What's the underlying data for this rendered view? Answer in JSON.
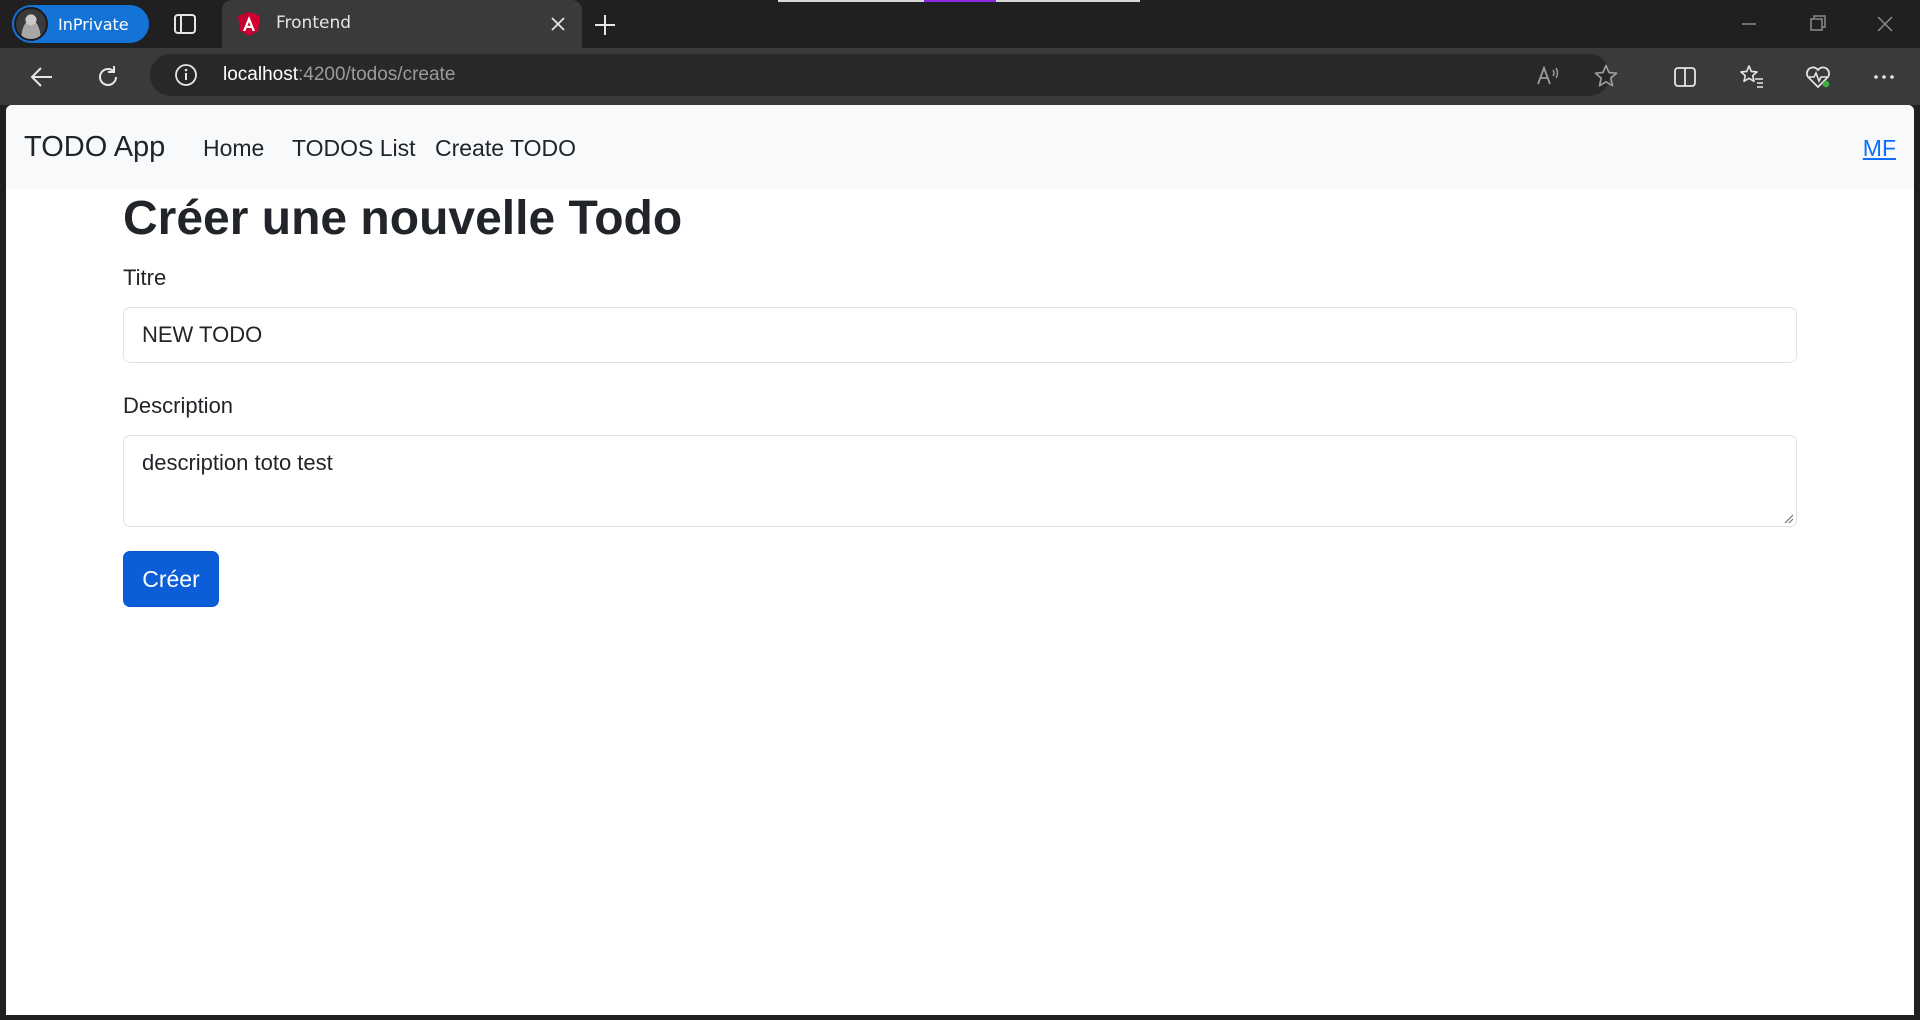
{
  "browser": {
    "profile_label": "InPrivate",
    "tab_title": "Frontend",
    "url_host": "localhost",
    "url_path": ":4200/todos/create"
  },
  "app": {
    "brand": "TODO App",
    "nav": [
      {
        "label": "Home"
      },
      {
        "label": "TODOS List"
      },
      {
        "label": "Create TODO"
      }
    ],
    "user_initials": "MF"
  },
  "form": {
    "heading": "Créer une nouvelle Todo",
    "title_label": "Titre",
    "title_value": "NEW TODO",
    "description_label": "Description",
    "description_value": "description toto test",
    "submit_label": "Créer"
  },
  "colors": {
    "primary": "#0d6efd",
    "navbar_bg": "#f8f9fa",
    "inprivate_badge": "#1473d6"
  }
}
